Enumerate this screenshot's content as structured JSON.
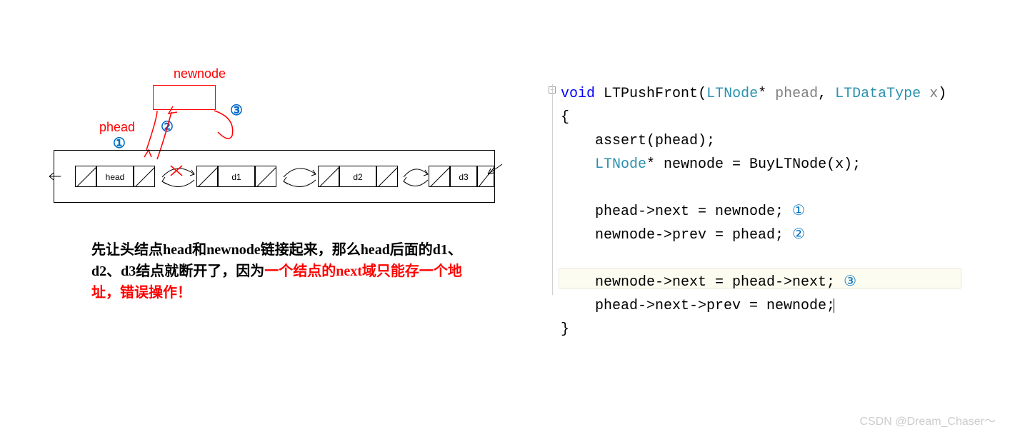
{
  "diagram": {
    "newnode_label": "newnode",
    "phead_label": "phead",
    "circled_1": "①",
    "circled_2": "②",
    "circled_3": "③",
    "nodes": {
      "head": "head",
      "d1": "d1",
      "d2": "d2",
      "d3": "d3"
    }
  },
  "explanation": {
    "line1_black": "先让头结点head和newnode链接起来，那么head后面的d1、d2、d3结点就断开了，因为",
    "line1_red": "一个结点的next域只能存一个地址，错误操作！"
  },
  "code": {
    "tokens": {
      "void": "void",
      "func": "LTPushFront",
      "type1": "LTNode",
      "param1": "phead",
      "type2": "LTDataType",
      "param2": "x",
      "assert_line": "    assert(phead);",
      "newnode_decl_a": "    ",
      "newnode_type": "LTNode",
      "newnode_decl_b": "* newnode = BuyLTNode(x);",
      "l1": "    phead->next = newnode;",
      "l1_num": " ①",
      "l2": "    newnode->prev = phead;",
      "l2_num": " ②",
      "l3": "    newnode->next = phead->next;",
      "l3_num": " ③",
      "l4": "    phead->next->prev = newnode;"
    }
  },
  "watermark": "CSDN @Dream_Chaser～"
}
